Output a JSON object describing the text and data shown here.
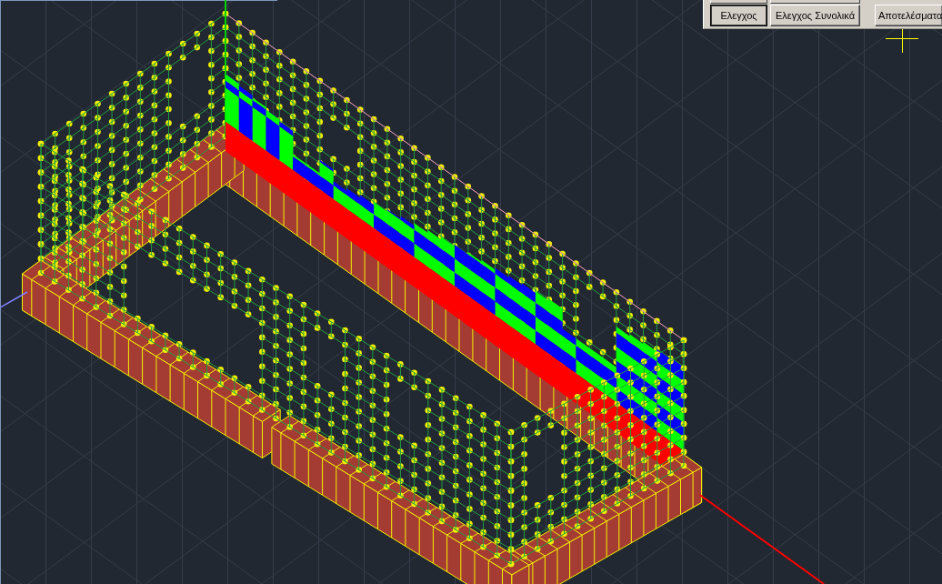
{
  "toolbar": {
    "upper_row": [
      {
        "kind": "button"
      },
      {
        "kind": "button"
      }
    ],
    "buttons": [
      {
        "label": "Ελεγχος",
        "selected": true
      },
      {
        "label": "Ελεγχος Συνολικά",
        "selected": false
      },
      {
        "label": "Αποτελέσματα",
        "selected": false
      }
    ]
  }
}
